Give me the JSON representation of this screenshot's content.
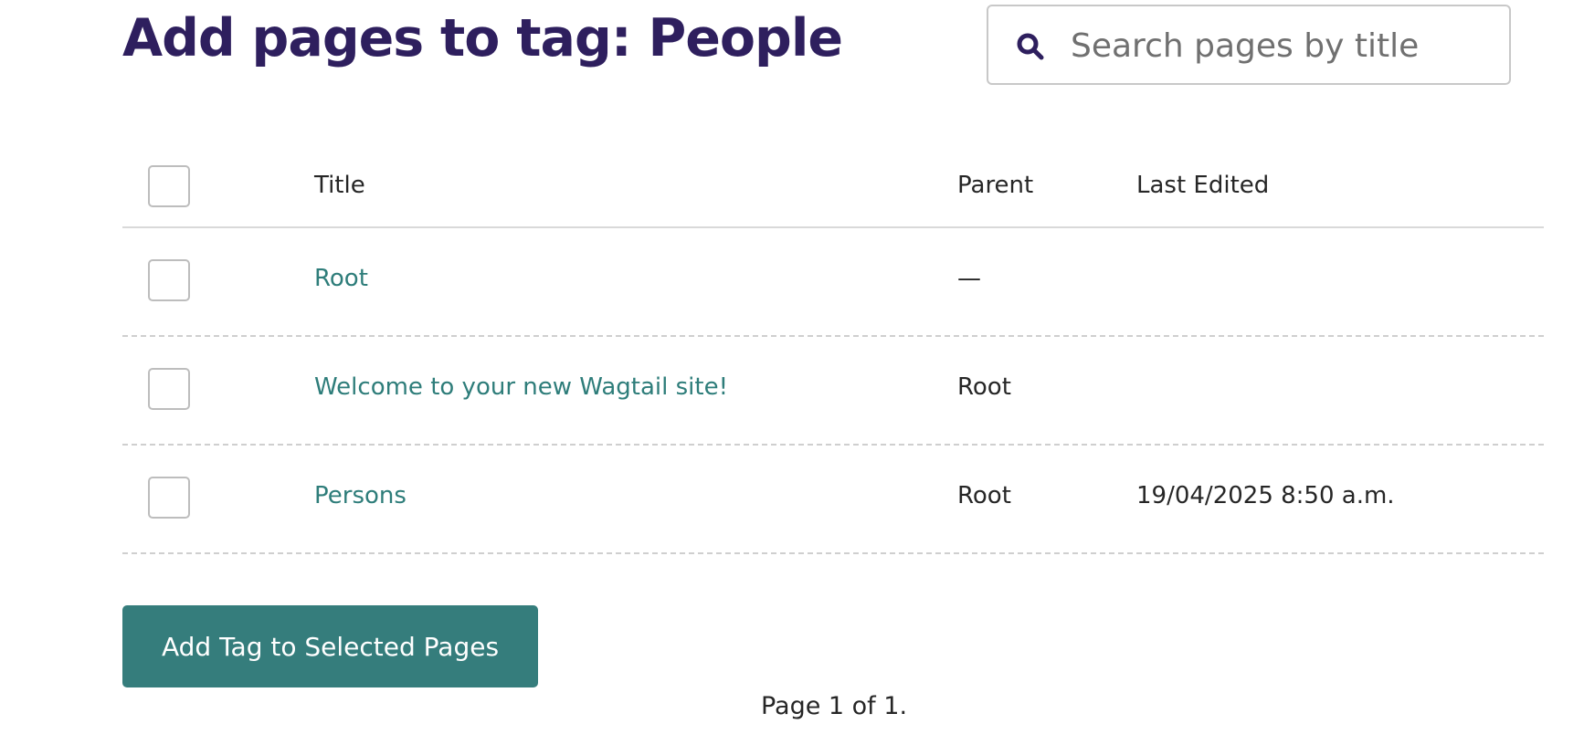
{
  "header": {
    "title": "Add pages to tag: People"
  },
  "search": {
    "placeholder": "Search pages by title",
    "value": "",
    "icon": "search-icon"
  },
  "table": {
    "columns": {
      "title": "Title",
      "parent": "Parent",
      "last_edited": "Last Edited"
    },
    "rows": [
      {
        "title": "Root",
        "parent": "—",
        "last_edited": ""
      },
      {
        "title": "Welcome to your new Wagtail site!",
        "parent": "Root",
        "last_edited": ""
      },
      {
        "title": "Persons",
        "parent": "Root",
        "last_edited": "19/04/2025 8:50 a.m."
      }
    ]
  },
  "actions": {
    "submit_label": "Add Tag to Selected Pages"
  },
  "pagination": {
    "text": "Page 1 of 1."
  },
  "colors": {
    "title": "#2e1f5e",
    "link": "#2e7d7a",
    "button": "#357d7c"
  }
}
